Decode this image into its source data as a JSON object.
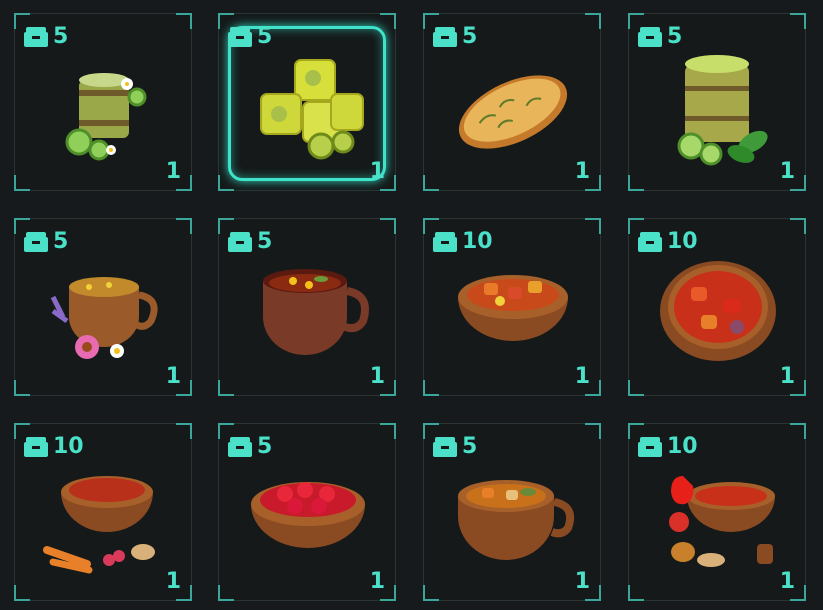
{
  "inventory": {
    "items": [
      {
        "name": "bamboo-cucumber-drink",
        "cost": "5",
        "qty": "1",
        "icon": "bamboo-cup-icon"
      },
      {
        "name": "gooseberry-jelly-cubes",
        "cost": "5",
        "qty": "1",
        "icon": "jelly-cubes-icon",
        "selected": true
      },
      {
        "name": "herb-toast",
        "cost": "5",
        "qty": "1",
        "icon": "toast-icon"
      },
      {
        "name": "bamboo-green-drink",
        "cost": "5",
        "qty": "1",
        "icon": "bamboo-cup-icon"
      },
      {
        "name": "flower-herbal-tea",
        "cost": "5",
        "qty": "1",
        "icon": "wooden-cup-icon"
      },
      {
        "name": "clay-cup-tea",
        "cost": "5",
        "qty": "1",
        "icon": "tea-cup-icon"
      },
      {
        "name": "vegetable-stew-bowl",
        "cost": "10",
        "qty": "1",
        "icon": "bowl-icon"
      },
      {
        "name": "roasted-pepper-bowl",
        "cost": "10",
        "qty": "1",
        "icon": "bowl-icon"
      },
      {
        "name": "carrot-ginger-bowl",
        "cost": "10",
        "qty": "1",
        "icon": "bowl-icon"
      },
      {
        "name": "strawberry-bowl",
        "cost": "5",
        "qty": "1",
        "icon": "bowl-icon"
      },
      {
        "name": "vegetable-soup-cup",
        "cost": "5",
        "qty": "1",
        "icon": "soup-cup-icon"
      },
      {
        "name": "pepper-stew-bowl",
        "cost": "10",
        "qty": "1",
        "icon": "bowl-icon"
      }
    ]
  },
  "colors": {
    "accent": "#4be0c8",
    "selection": "#3fe3c9",
    "background": "#161a1c"
  }
}
